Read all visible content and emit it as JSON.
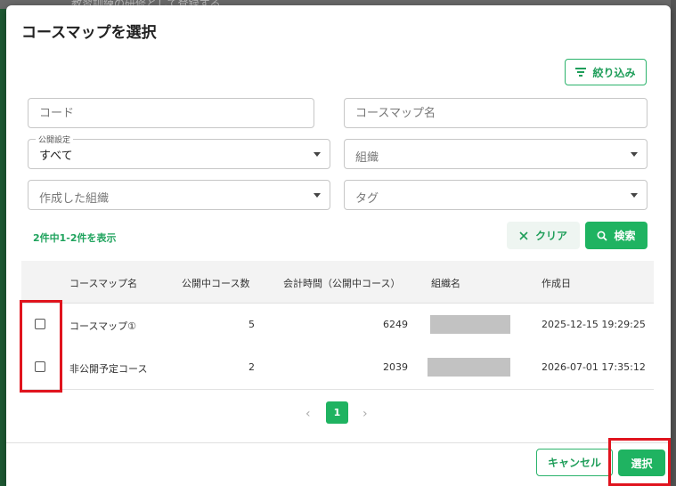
{
  "background": {
    "partial_text": "教習訓練の研修として登録する"
  },
  "dialog": {
    "title": "コースマップを選択",
    "filter_button": "絞り込み",
    "fields": {
      "code_placeholder": "コード",
      "name_placeholder": "コースマップ名",
      "visibility_label": "公開設定",
      "visibility_value": "すべて",
      "organization_placeholder": "組織",
      "created_org_placeholder": "作成した組織",
      "tag_placeholder": "タグ"
    },
    "result_count": "2件中1-2件を表示",
    "clear_button": "クリア",
    "search_button": "検索",
    "table": {
      "headers": [
        "コースマップ名",
        "公開中コース数",
        "会計時間（公開中コース）",
        "組織名",
        "作成日"
      ],
      "rows": [
        {
          "name": "コースマップ①",
          "courses": "5",
          "time": "6249",
          "org": "",
          "created": "2025-12-15 19:29:25"
        },
        {
          "name": "非公開予定コース",
          "courses": "2",
          "time": "2039",
          "org": "",
          "created": "2026-07-01 17:35:12"
        }
      ]
    },
    "pagination": {
      "prev": "‹",
      "current": "1",
      "next": "›"
    },
    "cancel_button": "キャンセル",
    "select_button": "選択"
  },
  "colors": {
    "accent": "#1fb361",
    "highlight": "#e0141e"
  }
}
